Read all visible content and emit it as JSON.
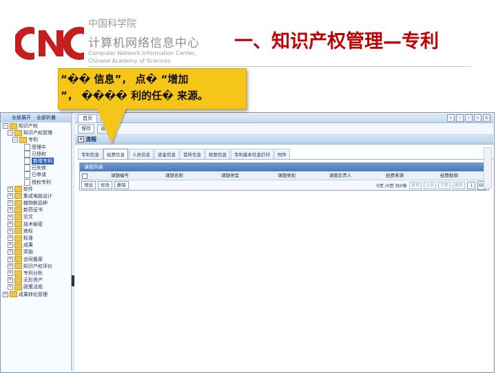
{
  "header": {
    "org_cn": "中国科学院",
    "org_center": "计算机网络信息中心",
    "org_en_1": "Computer Network Information Center,",
    "org_en_2": "Chinese Academy of Sciences",
    "slide_title": "一、知识产权管理—专利",
    "colors": {
      "title": "#c00000",
      "logo": "#c41e1e"
    }
  },
  "callout": {
    "line1": "“�� 信息”， 点� “增加",
    "line2": "”， ���� 利的任� 来源。",
    "color": "#f5c518"
  },
  "sidebar": {
    "expand_all": "全部展开",
    "collapse_all": "全部折叠",
    "items": [
      {
        "label": "知识产权",
        "level": 0,
        "exp": "−",
        "type": "folder"
      },
      {
        "label": "知识产权管理",
        "level": 1,
        "exp": "−",
        "type": "folder"
      },
      {
        "label": "专利",
        "level": 2,
        "exp": "−",
        "type": "folder"
      },
      {
        "label": "受理中",
        "level": 3,
        "type": "doc"
      },
      {
        "label": "已授权",
        "level": 3,
        "type": "doc"
      },
      {
        "label": "新增专利",
        "level": 3,
        "type": "doc",
        "selected": true
      },
      {
        "label": "已失效",
        "level": 3,
        "type": "doc"
      },
      {
        "label": "已申请",
        "level": 3,
        "type": "doc"
      },
      {
        "label": "授权专利",
        "level": 3,
        "type": "doc"
      },
      {
        "label": "软件",
        "level": 1,
        "exp": "+",
        "type": "folder"
      },
      {
        "label": "集成电路设计",
        "level": 1,
        "exp": "+",
        "type": "folder"
      },
      {
        "label": "植物新品种",
        "level": 1,
        "exp": "+",
        "type": "folder"
      },
      {
        "label": "新药证书",
        "level": 1,
        "exp": "+",
        "type": "folder"
      },
      {
        "label": "论文",
        "level": 1,
        "exp": "+",
        "type": "folder"
      },
      {
        "label": "技术秘密",
        "level": 1,
        "exp": "+",
        "type": "folder"
      },
      {
        "label": "商标",
        "level": 1,
        "exp": "+",
        "type": "folder"
      },
      {
        "label": "标准",
        "level": 1,
        "exp": "+",
        "type": "folder"
      },
      {
        "label": "成果",
        "level": 1,
        "exp": "+",
        "type": "folder"
      },
      {
        "label": "奖励",
        "level": 1,
        "exp": "+",
        "type": "folder"
      },
      {
        "label": "合同备案",
        "level": 1,
        "exp": "+",
        "type": "folder"
      },
      {
        "label": "知识产权评价",
        "level": 1,
        "exp": "+",
        "type": "folder"
      },
      {
        "label": "专利分析",
        "level": 1,
        "exp": "+",
        "type": "folder"
      },
      {
        "label": "无形资产",
        "level": 1,
        "exp": "+",
        "type": "folder"
      },
      {
        "label": "政策法规",
        "level": 1,
        "exp": "+",
        "type": "folder"
      },
      {
        "label": "成果转化管理",
        "level": 0,
        "exp": "+",
        "type": "folder"
      }
    ]
  },
  "main": {
    "tab_home": "首页",
    "nav_buttons": [
      "«",
      "‹",
      "›",
      "»",
      "↻"
    ],
    "toolbar": {
      "save": "保存",
      "back": "返回"
    },
    "section_title": "流程",
    "subtabs": [
      "专利信息",
      "经费信息",
      "人员信息",
      "资金信息",
      "首所信息",
      "权限信息",
      "专利基本信息打印",
      "附件"
    ],
    "active_subtab": 1,
    "grid": {
      "title": "课题列表",
      "columns": [
        "课题编号",
        "课题名称",
        "课题类型",
        "课题类别",
        "课题负责人",
        "经费来源",
        "经费数额"
      ],
      "footer_buttons": [
        "增加",
        "修改",
        "删除"
      ],
      "pager": {
        "summary": "0页 /0页 共0条",
        "first": "首页",
        "prev": "上页",
        "next": "下页",
        "last": "尾页",
        "page": "1",
        "go": "GO"
      }
    }
  }
}
